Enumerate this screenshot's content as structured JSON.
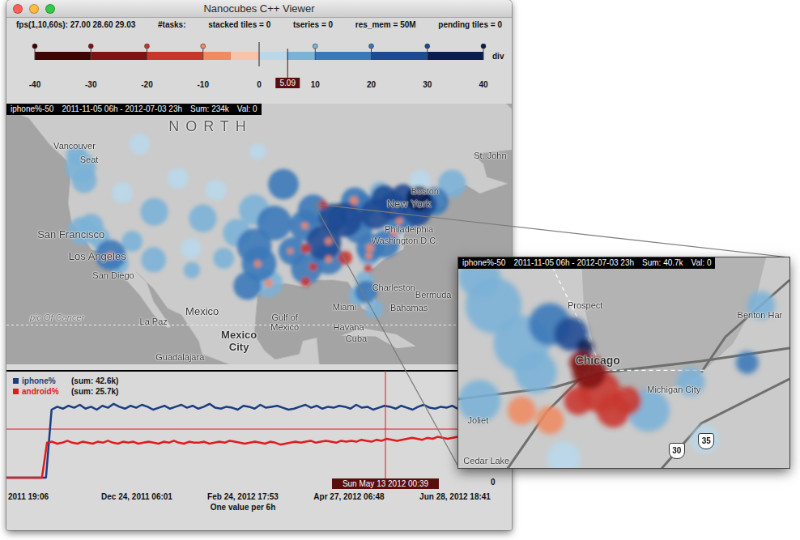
{
  "window": {
    "title": "Nanocubes C++ Viewer"
  },
  "status": [
    "fps(1,10,60s): 27.00 28.60 29.03",
    "#tasks:",
    "stacked tiles = 0",
    "tseries = 0",
    "res_mem = 50M",
    "pending tiles = 0"
  ],
  "colorbar": {
    "ticks": [
      "-40",
      "-30",
      "-20",
      "-10",
      "0",
      "10",
      "20",
      "30",
      "40"
    ],
    "min": -40,
    "max": 40,
    "name": "div",
    "marker": {
      "label": "5.09",
      "value": 5.09
    }
  },
  "map": {
    "header": {
      "layer": "iphone%-50",
      "range": "2011-11-05 06h - 2012-07-03 23h",
      "sum": "Sum: 234k",
      "val": "Val: 0"
    },
    "labels": [
      {
        "text": "NORTH",
        "lon": -103.8,
        "lat": 53.6,
        "kind": "region"
      },
      {
        "text": "Vancouver",
        "lon": -123.4,
        "lat": 50.8,
        "kind": "city"
      },
      {
        "text": "Seat",
        "lon": -121.3,
        "lat": 48.7,
        "kind": "city"
      },
      {
        "text": "San Francisco",
        "lon": -123.9,
        "lat": 37.2,
        "kind": "major"
      },
      {
        "text": "Los Angeles",
        "lon": -120.1,
        "lat": 33.9,
        "kind": "major"
      },
      {
        "text": "San Diego",
        "lon": -117.8,
        "lat": 31.0,
        "kind": "city"
      },
      {
        "text": "Boston",
        "lon": -72.9,
        "lat": 43.9,
        "kind": "city"
      },
      {
        "text": "New York",
        "lon": -75.2,
        "lat": 41.9,
        "kind": "major"
      },
      {
        "text": "Philadelphia",
        "lon": -75.2,
        "lat": 38.1,
        "kind": "city"
      },
      {
        "text": "Washington D.C.",
        "lon": -75.8,
        "lat": 36.3,
        "kind": "city"
      },
      {
        "text": "St. John",
        "lon": -63.5,
        "lat": 49.3,
        "kind": "city"
      },
      {
        "text": "Charleston",
        "lon": -77.4,
        "lat": 29.2,
        "kind": "city"
      },
      {
        "text": "Bermuda",
        "lon": -71.7,
        "lat": 28.1,
        "kind": "city"
      },
      {
        "text": "Miami",
        "lon": -84.5,
        "lat": 26.2,
        "kind": "city"
      },
      {
        "text": "Bahamas",
        "lon": -75.2,
        "lat": 26.1,
        "kind": "city"
      },
      {
        "text": "Gulf of Mexico",
        "lon": -93.1,
        "lat": 23.9,
        "kind": "sea"
      },
      {
        "text": "Havana",
        "lon": -83.9,
        "lat": 23.1,
        "kind": "city"
      },
      {
        "text": "Cuba",
        "lon": -82.8,
        "lat": 21.4,
        "kind": "city"
      },
      {
        "text": "Mexico",
        "lon": -105.0,
        "lat": 25.5,
        "kind": "major"
      },
      {
        "text": "La Paz",
        "lon": -112.0,
        "lat": 24.0,
        "kind": "city"
      },
      {
        "text": "Mexico City",
        "lon": -99.7,
        "lat": 21.0,
        "kind": "capital"
      },
      {
        "text": "Guadalajara",
        "lon": -108.2,
        "lat": 18.6,
        "kind": "city"
      },
      {
        "text": "pic Of Cancer",
        "lon": -125.9,
        "lat": 24.6,
        "kind": "line"
      }
    ],
    "heat": [
      {
        "lon": -122.5,
        "lat": 47.5,
        "r": 2.2,
        "value": 6
      },
      {
        "lon": -122.0,
        "lat": 45.5,
        "r": 1.8,
        "value": 5
      },
      {
        "lon": -122.3,
        "lat": 37.8,
        "r": 2.0,
        "value": 8
      },
      {
        "lon": -121.0,
        "lat": 38.5,
        "r": 1.8,
        "value": 5
      },
      {
        "lon": -118.2,
        "lat": 34.1,
        "r": 2.2,
        "value": 12
      },
      {
        "lon": -117.1,
        "lat": 32.8,
        "r": 1.5,
        "value": 8
      },
      {
        "lon": -112.0,
        "lat": 33.4,
        "r": 1.8,
        "value": 6
      },
      {
        "lon": -111.9,
        "lat": 40.7,
        "r": 2.0,
        "value": 8
      },
      {
        "lon": -104.9,
        "lat": 39.7,
        "r": 2.0,
        "value": 8
      },
      {
        "lon": -115.1,
        "lat": 36.2,
        "r": 1.5,
        "value": 6
      },
      {
        "lon": -116.5,
        "lat": 43.6,
        "r": 1.5,
        "value": 4
      },
      {
        "lon": -106.6,
        "lat": 35.1,
        "r": 1.5,
        "value": 4
      },
      {
        "lon": -119.8,
        "lat": 36.7,
        "r": 1.5,
        "value": 5
      },
      {
        "lon": -97.5,
        "lat": 35.5,
        "r": 2.5,
        "value": 12
      },
      {
        "lon": -96.8,
        "lat": 32.8,
        "r": 2.5,
        "value": 14
      },
      {
        "lon": -95.4,
        "lat": 29.8,
        "r": 2.0,
        "value": 8
      },
      {
        "lon": -98.5,
        "lat": 29.4,
        "r": 2.0,
        "value": 10
      },
      {
        "lon": -94.6,
        "lat": 39.0,
        "r": 2.5,
        "value": 15
      },
      {
        "lon": -93.3,
        "lat": 44.9,
        "r": 2.2,
        "value": 10
      },
      {
        "lon": -90.2,
        "lat": 38.6,
        "r": 2.2,
        "value": 18
      },
      {
        "lon": -87.5,
        "lat": 36.0,
        "r": 2.5,
        "value": 20
      },
      {
        "lon": -86.8,
        "lat": 33.5,
        "r": 2.2,
        "value": 16
      },
      {
        "lon": -92.0,
        "lat": 34.7,
        "r": 2.0,
        "value": 18
      },
      {
        "lon": -90.0,
        "lat": 32.0,
        "r": 2.2,
        "value": 15
      },
      {
        "lon": -89.0,
        "lat": 41.0,
        "r": 2.2,
        "value": 12
      },
      {
        "lon": -84.5,
        "lat": 39.5,
        "r": 2.5,
        "value": 22
      },
      {
        "lon": -86.2,
        "lat": 39.8,
        "r": 2.0,
        "value": 20
      },
      {
        "lon": -83.0,
        "lat": 40.0,
        "r": 2.0,
        "value": 18
      },
      {
        "lon": -97.5,
        "lat": 41.0,
        "r": 2.2,
        "value": 8
      },
      {
        "lon": -100.0,
        "lat": 37.5,
        "r": 2.0,
        "value": 7
      },
      {
        "lon": -101.9,
        "lat": 33.6,
        "r": 1.5,
        "value": 6
      },
      {
        "lon": -106.5,
        "lat": 31.8,
        "r": 1.2,
        "value": 5
      },
      {
        "lon": -103.0,
        "lat": 44.0,
        "r": 1.5,
        "value": 4
      },
      {
        "lon": -108.5,
        "lat": 45.8,
        "r": 1.5,
        "value": 4
      },
      {
        "lon": -83.0,
        "lat": 42.3,
        "r": 2.0,
        "value": 14
      },
      {
        "lon": -80.0,
        "lat": 40.4,
        "r": 2.2,
        "value": 22
      },
      {
        "lon": -78.8,
        "lat": 42.9,
        "r": 1.8,
        "value": 20
      },
      {
        "lon": -76.0,
        "lat": 43.0,
        "r": 1.8,
        "value": 28
      },
      {
        "lon": -77.5,
        "lat": 41.5,
        "r": 2.0,
        "value": 26
      },
      {
        "lon": -74.0,
        "lat": 40.7,
        "r": 2.0,
        "value": 20
      },
      {
        "lon": -71.5,
        "lat": 42.3,
        "r": 2.0,
        "value": 18
      },
      {
        "lon": -73.8,
        "lat": 42.7,
        "r": 1.8,
        "value": 32
      },
      {
        "lon": -75.2,
        "lat": 40.0,
        "r": 1.8,
        "value": 15
      },
      {
        "lon": -77.0,
        "lat": 38.9,
        "r": 1.5,
        "value": 10
      },
      {
        "lon": -72.7,
        "lat": 41.8,
        "r": 1.5,
        "value": 22
      },
      {
        "lon": -69.0,
        "lat": 45.0,
        "r": 2.0,
        "value": 8
      },
      {
        "lon": -80.8,
        "lat": 35.2,
        "r": 2.0,
        "value": 12
      },
      {
        "lon": -78.6,
        "lat": 35.8,
        "r": 2.0,
        "value": 10
      },
      {
        "lon": -81.0,
        "lat": 34.0,
        "r": 1.5,
        "value": 8
      },
      {
        "lon": -82.5,
        "lat": 38.0,
        "r": 2.0,
        "value": 16
      },
      {
        "lon": -81.7,
        "lat": 41.5,
        "r": 1.8,
        "value": 18
      },
      {
        "lon": -81.4,
        "lat": 28.5,
        "r": 1.6,
        "value": 10
      },
      {
        "lon": -82.5,
        "lat": 27.9,
        "r": 1.4,
        "value": 8
      },
      {
        "lon": -80.2,
        "lat": 25.9,
        "r": 1.3,
        "value": 6
      },
      {
        "lon": -81.6,
        "lat": 30.3,
        "r": 1.3,
        "value": 8
      },
      {
        "lon": -79.4,
        "lat": 43.7,
        "r": 1.5,
        "value": 6
      },
      {
        "lon": -73.6,
        "lat": 45.5,
        "r": 1.5,
        "value": 4
      },
      {
        "lon": -123.1,
        "lat": 49.3,
        "r": 1.5,
        "value": 6
      },
      {
        "lon": -114.0,
        "lat": 51.0,
        "r": 1.5,
        "value": 4
      },
      {
        "lon": -97.0,
        "lat": 49.9,
        "r": 1.2,
        "value": 4
      },
      {
        "lon": -84.4,
        "lat": 33.7,
        "r": 1.0,
        "value": -15
      },
      {
        "lon": -80.8,
        "lat": 35.2,
        "r": 0.6,
        "value": -8
      },
      {
        "lon": -87.6,
        "lat": 41.8,
        "r": 0.6,
        "value": -10
      },
      {
        "lon": -90.1,
        "lat": 35.1,
        "r": 0.7,
        "value": -12
      },
      {
        "lon": -90.1,
        "lat": 30.0,
        "r": 0.7,
        "value": -10
      },
      {
        "lon": -86.8,
        "lat": 33.5,
        "r": 0.5,
        "value": -8
      },
      {
        "lon": -81.1,
        "lat": 32.1,
        "r": 0.6,
        "value": -12
      },
      {
        "lon": -83.1,
        "lat": 42.4,
        "r": 0.6,
        "value": -8
      },
      {
        "lon": -90.2,
        "lat": 38.6,
        "r": 0.5,
        "value": -6
      },
      {
        "lon": -95.4,
        "lat": 29.8,
        "r": 0.6,
        "value": -6
      },
      {
        "lon": -97.0,
        "lat": 32.8,
        "r": 0.5,
        "value": -5
      },
      {
        "lon": -77.4,
        "lat": 37.5,
        "r": 0.5,
        "value": -6
      },
      {
        "lon": -118.3,
        "lat": 34.0,
        "r": 0.5,
        "value": -5
      },
      {
        "lon": -86.8,
        "lat": 36.2,
        "r": 0.5,
        "value": -5
      },
      {
        "lon": -92.3,
        "lat": 34.7,
        "r": 0.4,
        "value": -6
      },
      {
        "lon": -89.0,
        "lat": 32.3,
        "r": 0.6,
        "value": -10
      },
      {
        "lon": -81.0,
        "lat": 34.0,
        "r": 0.5,
        "value": -8
      },
      {
        "lon": -76.6,
        "lat": 39.3,
        "r": 0.5,
        "value": -6
      }
    ]
  },
  "timeseries": {
    "series": [
      {
        "name": "iphone%",
        "sum": "(sum: 42.6k)",
        "color": "#1a3d82",
        "values": [
          0,
          0,
          0,
          0,
          0,
          0,
          0,
          0,
          70,
          73,
          71,
          74,
          72,
          75,
          71,
          73,
          70,
          74,
          72,
          76,
          73,
          71,
          74,
          72,
          75,
          73,
          70,
          72,
          74,
          71,
          73,
          75,
          72,
          74,
          71,
          73,
          76,
          72,
          71,
          73,
          72,
          70,
          74,
          73,
          71,
          75,
          72,
          73,
          74,
          72,
          70,
          71,
          73,
          75,
          72,
          74,
          71,
          73,
          72,
          74,
          73,
          71,
          75,
          72,
          73,
          70,
          72,
          74,
          73,
          71,
          74,
          72,
          70,
          73,
          75,
          72,
          71,
          73,
          72,
          74,
          71,
          73,
          72,
          70,
          74,
          73,
          71,
          72,
          73,
          71
        ]
      },
      {
        "name": "android%",
        "sum": "(sum: 25.7k)",
        "color": "#e3191c",
        "values": [
          0,
          0,
          0,
          0,
          0,
          0,
          0,
          0,
          36,
          37,
          35,
          36,
          38,
          36,
          35,
          37,
          36,
          35,
          37,
          36,
          38,
          36,
          35,
          37,
          36,
          37,
          35,
          36,
          37,
          36,
          35,
          37,
          36,
          38,
          36,
          35,
          37,
          36,
          36,
          37,
          35,
          36,
          37,
          36,
          38,
          37,
          36,
          35,
          36,
          37,
          36,
          35,
          37,
          36,
          34,
          35,
          36,
          37,
          36,
          37,
          38,
          36,
          37,
          38,
          37,
          36,
          38,
          37,
          38,
          37,
          39,
          38,
          37,
          39,
          38,
          40,
          39,
          38,
          39,
          40,
          41,
          40,
          39,
          41,
          40,
          42,
          41,
          40,
          41,
          42,
          41,
          43,
          42,
          41,
          43,
          42,
          44,
          43,
          42,
          43
        ]
      }
    ],
    "reference": 50,
    "y_tick": "0",
    "cursor": {
      "label": "Sun May 13 2012 00:39",
      "level": 0.75
    },
    "x_ticks": [
      "2011 19:06",
      "Dec 24, 2011 06:01",
      "Feb 24, 2012 17:53",
      "Apr 27, 2012 06:48",
      "Jun 28, 2012 18:41"
    ],
    "x_caption": "One value per 6h"
  },
  "inset": {
    "header": {
      "layer": "iphone%-50",
      "range": "2011-11-05 06h - 2012-07-03 23h",
      "sum": "Sum: 40.7k",
      "val": "Val: 0"
    },
    "labels": [
      {
        "text": "Prospect",
        "lon": -87.65,
        "lat": 42.1,
        "kind": "city"
      },
      {
        "text": "Chicago",
        "lon": -87.56,
        "lat": 41.81,
        "kind": "hub"
      },
      {
        "text": "Michigan City",
        "lon": -87.02,
        "lat": 41.66,
        "kind": "city"
      },
      {
        "text": "Benton Har",
        "lon": -86.41,
        "lat": 42.05,
        "kind": "city"
      },
      {
        "text": "Joliet",
        "lon": -88.41,
        "lat": 41.5,
        "kind": "city"
      },
      {
        "text": "Cedar Lake",
        "lon": -88.35,
        "lat": 41.29,
        "kind": "city"
      },
      {
        "text": "35",
        "lon": -86.79,
        "lat": 41.39,
        "kind": "shield"
      },
      {
        "text": "30",
        "lon": -87.0,
        "lat": 41.34,
        "kind": "shield"
      }
    ],
    "heat": [
      {
        "lon": -87.9,
        "lat": 42.0,
        "r": 0.15,
        "value": 12
      },
      {
        "lon": -88.1,
        "lat": 41.9,
        "r": 0.2,
        "value": 8
      },
      {
        "lon": -87.75,
        "lat": 41.95,
        "r": 0.12,
        "value": 20
      },
      {
        "lon": -87.65,
        "lat": 41.88,
        "r": 0.06,
        "value": 30
      },
      {
        "lon": -88.3,
        "lat": 42.1,
        "r": 0.2,
        "value": 6
      },
      {
        "lon": -88.0,
        "lat": 41.75,
        "r": 0.15,
        "value": 6
      },
      {
        "lon": -87.2,
        "lat": 41.55,
        "r": 0.15,
        "value": 5
      },
      {
        "lon": -86.9,
        "lat": 41.7,
        "r": 0.1,
        "value": 5
      },
      {
        "lon": -86.5,
        "lat": 41.8,
        "r": 0.08,
        "value": 10
      },
      {
        "lon": -86.4,
        "lat": 42.1,
        "r": 0.1,
        "value": 6
      },
      {
        "lon": -88.4,
        "lat": 41.6,
        "r": 0.15,
        "value": 5
      },
      {
        "lon": -88.4,
        "lat": 42.25,
        "r": 0.15,
        "value": 5
      },
      {
        "lon": -87.8,
        "lat": 41.3,
        "r": 0.12,
        "value": 4
      },
      {
        "lon": -86.8,
        "lat": 41.4,
        "r": 0.1,
        "value": 4
      },
      {
        "lon": -87.68,
        "lat": 41.8,
        "r": 0.08,
        "value": -25
      },
      {
        "lon": -87.62,
        "lat": 41.75,
        "r": 0.12,
        "value": -20
      },
      {
        "lon": -87.55,
        "lat": 41.65,
        "r": 0.15,
        "value": -18
      },
      {
        "lon": -87.35,
        "lat": 41.6,
        "r": 0.1,
        "value": -15
      },
      {
        "lon": -87.7,
        "lat": 41.6,
        "r": 0.1,
        "value": -12
      },
      {
        "lon": -87.45,
        "lat": 41.55,
        "r": 0.12,
        "value": -10
      },
      {
        "lon": -88.1,
        "lat": 41.55,
        "r": 0.1,
        "value": -8
      },
      {
        "lon": -87.9,
        "lat": 41.5,
        "r": 0.1,
        "value": -6
      }
    ]
  }
}
